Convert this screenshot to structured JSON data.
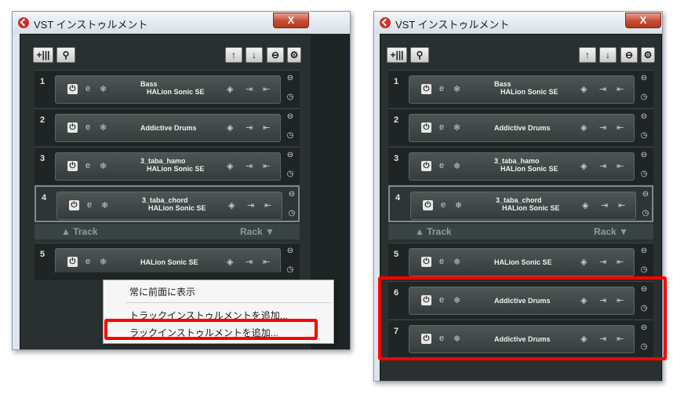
{
  "window_title": "VST インストゥルメント",
  "close_glyph": "X",
  "toolbar": {
    "add_glyph": "+|||",
    "search_glyph": "⚲",
    "up_glyph": "↑",
    "down_glyph": "↓",
    "collapse_glyph": "⊖",
    "settings_glyph": "⚙"
  },
  "slot_icons": {
    "power": "⏻",
    "edit": "e",
    "freeze": "❄",
    "preset": "◈",
    "in": "⇥",
    "out": "⇤"
  },
  "separator": {
    "track_label": "▲ Track",
    "rack_label": "Rack ▼"
  },
  "left": {
    "track_slots": [
      {
        "number": "1",
        "line1": "Bass",
        "line2": "HALion Sonic SE"
      },
      {
        "number": "2",
        "line1": "Addictive Drums",
        "line2": ""
      },
      {
        "number": "3",
        "line1": "3_taba_hamo",
        "line2": "HALion Sonic SE"
      },
      {
        "number": "4",
        "line1": "3_taba_chord",
        "line2": "HALion Sonic SE"
      }
    ],
    "rack_slots": [
      {
        "number": "5",
        "line1": "HALion Sonic SE",
        "line2": ""
      }
    ]
  },
  "context_menu": {
    "items": [
      "常に前面に表示",
      "トラックインストゥルメントを追加...",
      "ラックインストゥルメントを追加..."
    ]
  },
  "right": {
    "track_slots": [
      {
        "number": "1",
        "line1": "Bass",
        "line2": "HALion Sonic SE"
      },
      {
        "number": "2",
        "line1": "Addictive Drums",
        "line2": ""
      },
      {
        "number": "3",
        "line1": "3_taba_hamo",
        "line2": "HALion Sonic SE"
      },
      {
        "number": "4",
        "line1": "3_taba_chord",
        "line2": "HALion Sonic SE"
      }
    ],
    "rack_slots": [
      {
        "number": "5",
        "line1": "HALion Sonic SE",
        "line2": ""
      },
      {
        "number": "6",
        "line1": "Addictive Drums",
        "line2": ""
      },
      {
        "number": "7",
        "line1": "Addictive Drums",
        "line2": ""
      }
    ]
  },
  "colors": {
    "highlight": "#ff0000",
    "panel": "#2a3030",
    "brand": "#c8342b"
  }
}
